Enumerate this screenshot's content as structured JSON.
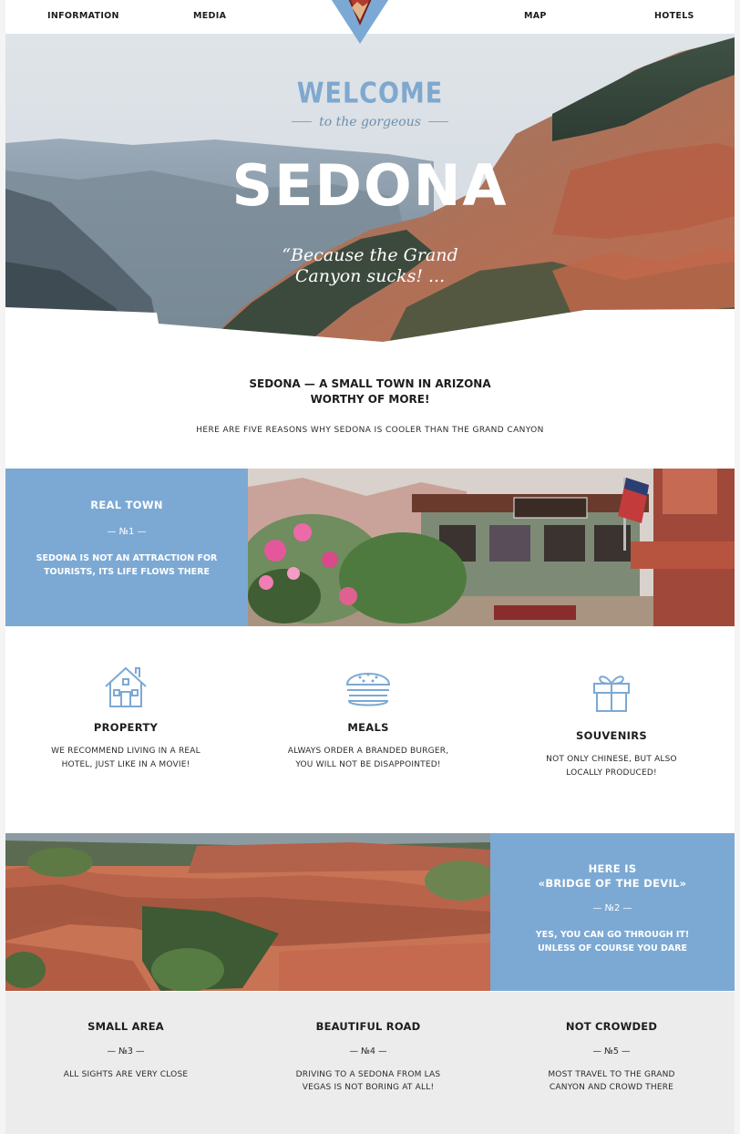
{
  "nav": {
    "information": "INFORMATION",
    "media": "MEDIA",
    "map": "MAP",
    "hotels": "HOTELS"
  },
  "hero": {
    "welcome": "WELCOME",
    "subtitle": "to the gorgeous",
    "title": "SEDONA",
    "tagline": "“Because the Grand Canyon sucks! ..."
  },
  "intro": {
    "title": "SEDONA — A SMALL TOWN IN ARIZONA WORTHY OF MORE!",
    "subtitle": "HERE ARE FIVE REASONS WHY SEDONA IS COOLER THAN THE GRAND CANYON"
  },
  "reason1": {
    "title": "REAL TOWN",
    "number": "— №1 —",
    "description": "SEDONA IS NOT AN ATTRACTION FOR TOURISTS, ITS LIFE FLOWS THERE"
  },
  "features": [
    {
      "icon": "house-icon",
      "title": "PROPERTY",
      "description": "WE RECOMMEND LIVING IN A REAL HOTEL, JUST LIKE IN A MOVIE!"
    },
    {
      "icon": "burger-icon",
      "title": "MEALS",
      "description": "ALWAYS ORDER A BRANDED BURGER, YOU WILL NOT BE DISAPPOINTED!"
    },
    {
      "icon": "gift-icon",
      "title": "SOUVENIRS",
      "description": "NOT ONLY CHINESE, BUT ALSO LOCALLY PRODUCED!"
    }
  ],
  "reason2": {
    "title_line1": "HERE IS",
    "title_line2": "«BRIDGE OF THE DEVIL»",
    "number": "— №2 —",
    "description": "YES, YOU CAN GO THROUGH IT! UNLESS OF COURSE YOU DARE"
  },
  "reasons_bottom": [
    {
      "title": "SMALL AREA",
      "number": "— №3 —",
      "description": "ALL SIGHTS ARE VERY CLOSE"
    },
    {
      "title": "BEAUTIFUL ROAD",
      "number": "— №4 —",
      "description": "DRIVING TO A SEDONA FROM LAS VEGAS IS NOT BORING AT ALL!"
    },
    {
      "title": "NOT CROWDED",
      "number": "— №5 —",
      "description": "MOST TRAVEL TO THE GRAND CANYON AND CROWD THERE"
    }
  ],
  "colors": {
    "accent_blue": "#7ca9d4",
    "bottom_bg": "#ececec",
    "text_dark": "#1d1d1d"
  }
}
